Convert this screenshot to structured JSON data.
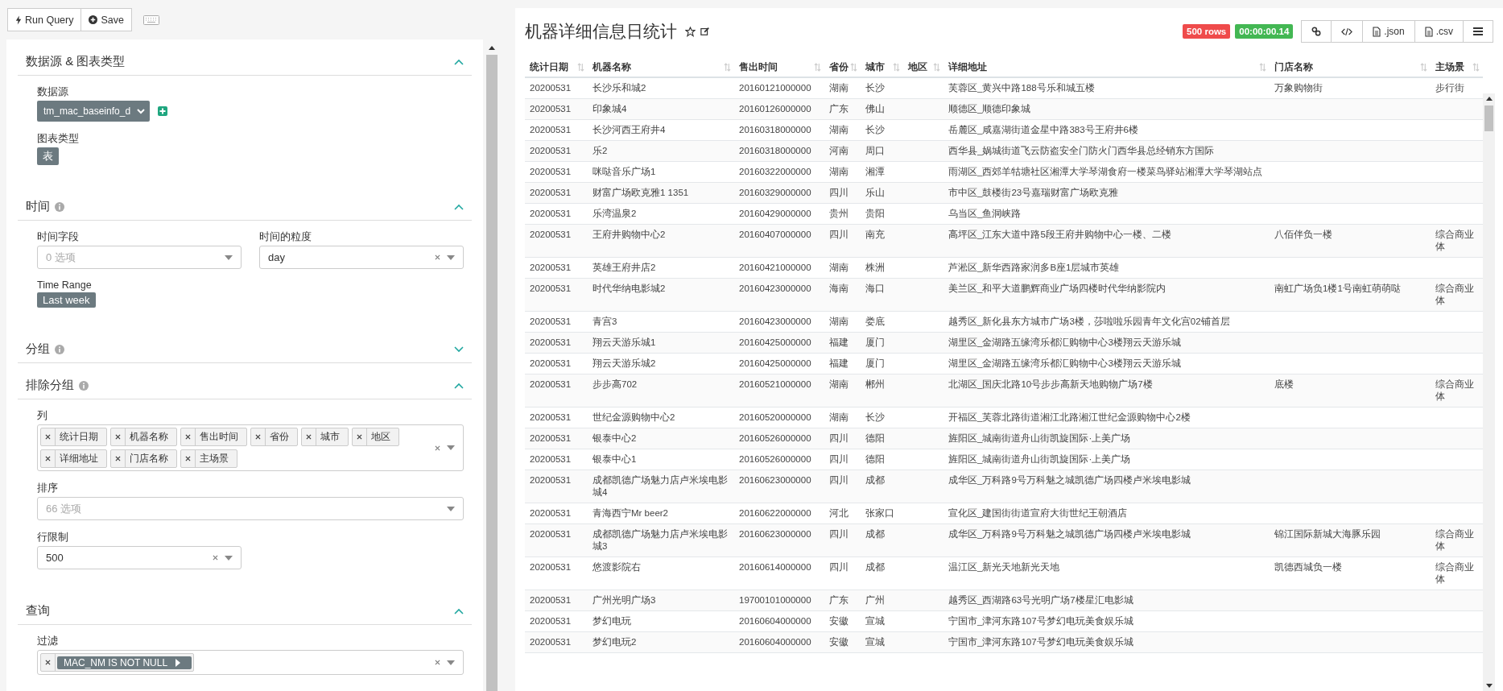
{
  "toolbar": {
    "buttons": [
      {
        "kind": "run",
        "label": "Run Query"
      },
      {
        "kind": "save",
        "label": "Save"
      }
    ]
  },
  "sections": [
    {
      "title": "数据源 & 图表类型",
      "info": false,
      "expanded": true,
      "controls": [
        {
          "kind": "datasource",
          "label": "数据源",
          "value": "tm_mac_baseinfo_d"
        },
        {
          "kind": "chip",
          "label": "图表类型",
          "value": "表"
        }
      ]
    },
    {
      "title": "时间",
      "info": true,
      "expanded": true,
      "controls": [
        {
          "kind": "select",
          "label": "时间字段",
          "placeholder": "0 选项",
          "clearable": false
        },
        {
          "kind": "select",
          "label": "时间的粒度",
          "value": "day",
          "clearable": true
        },
        {
          "kind": "chip",
          "label": "Time Range",
          "value": "Last week"
        }
      ]
    },
    {
      "title": "分组",
      "info": true,
      "expanded": false
    },
    {
      "title": "排除分组",
      "info": true,
      "expanded": true,
      "controls": [
        {
          "kind": "tags",
          "label": "列",
          "tags": [
            "统计日期",
            "机器名称",
            "售出时间",
            "省份",
            "城市",
            "地区",
            "详细地址",
            "门店名称",
            "主场景"
          ],
          "clearable": true
        },
        {
          "kind": "wide-select",
          "label": "排序",
          "placeholder": "66 选项",
          "clearable": false
        },
        {
          "kind": "select",
          "label": "行限制",
          "value": "500",
          "clearable": true
        }
      ]
    },
    {
      "title": "查询",
      "info": false,
      "expanded": true,
      "controls": [
        {
          "kind": "filters",
          "label": "过滤",
          "tags": [
            "MAC_NM IS NOT NULL"
          ],
          "clearable": true
        }
      ]
    }
  ],
  "result": {
    "title": "机器详细信息日统计",
    "row_count": "500 rows",
    "duration": "00:00:00.14",
    "actions": [
      {
        "kind": "link"
      },
      {
        "kind": "code"
      },
      {
        "kind": "json",
        "label": ".json"
      },
      {
        "kind": "csv",
        "label": ".csv"
      },
      {
        "kind": "menu"
      }
    ]
  },
  "table": {
    "columns": [
      "统计日期",
      "机器名称",
      "售出时间",
      "省份",
      "城市",
      "地区",
      "详细地址",
      "门店名称",
      "主场景"
    ],
    "rows": [
      [
        "20200531",
        "长沙乐和城2",
        "20160121000000",
        "湖南",
        "长沙",
        null,
        "芙蓉区_黄兴中路188号乐和城五楼",
        "万象购物街",
        "步行街"
      ],
      [
        "20200531",
        "印象城4",
        "20160126000000",
        "广东",
        "佛山",
        null,
        "顺德区_顺德印象城",
        null,
        null
      ],
      [
        "20200531",
        "长沙河西王府井4",
        "20160318000000",
        "湖南",
        "长沙",
        null,
        "岳麓区_咸嘉湖街道金星中路383号王府井6楼",
        null,
        null
      ],
      [
        "20200531",
        "乐2",
        "20160318000000",
        "河南",
        "周口",
        null,
        "西华县_娲城街道飞云防盗安全门防火门西华县总经销东方国际",
        null,
        null
      ],
      [
        "20200531",
        "咪哒音乐广场1",
        "20160322000000",
        "湖南",
        "湘潭",
        null,
        "雨湖区_西郊羊牯塘社区湘潭大学琴湖食府一楼菜鸟驿站湘潭大学琴湖站点",
        null,
        null
      ],
      [
        "20200531",
        "财富广场欧克雅1 1351",
        "20160329000000",
        "四川",
        "乐山",
        null,
        "市中区_鼓楼街23号嘉瑞财富广场欧克雅",
        null,
        null
      ],
      [
        "20200531",
        "乐湾温泉2",
        "20160429000000",
        "贵州",
        "贵阳",
        null,
        "乌当区_鱼洞峡路",
        null,
        null
      ],
      [
        "20200531",
        "王府井购物中心2",
        "20160407000000",
        "四川",
        "南充",
        null,
        "高坪区_江东大道中路5段王府井购物中心一楼、二楼",
        "八佰伴负一楼",
        "综合商业体"
      ],
      [
        "20200531",
        "英雄王府井店2",
        "20160421000000",
        "湖南",
        "株洲",
        null,
        "芦淞区_新华西路家润多B座1层城市英雄",
        null,
        null
      ],
      [
        "20200531",
        "时代华纳电影城2",
        "20160423000000",
        "海南",
        "海口",
        null,
        "美兰区_和平大道鹏辉商业广场四楼时代华纳影院内",
        "南虹广场负1楼1号南虹萌萌哒",
        "综合商业体"
      ],
      [
        "20200531",
        "青宫3",
        "20160423000000",
        "湖南",
        "娄底",
        null,
        "越秀区_新化县东方城市广场3楼，莎啦啦乐园青年文化宫02铺首层",
        null,
        null
      ],
      [
        "20200531",
        "翔云天游乐城1",
        "20160425000000",
        "福建",
        "厦门",
        null,
        "湖里区_金湖路五缘湾乐都汇购物中心3楼翔云天游乐城",
        null,
        null
      ],
      [
        "20200531",
        "翔云天游乐城2",
        "20160425000000",
        "福建",
        "厦门",
        null,
        "湖里区_金湖路五缘湾乐都汇购物中心3楼翔云天游乐城",
        null,
        null
      ],
      [
        "20200531",
        "步步高702",
        "20160521000000",
        "湖南",
        "郴州",
        null,
        "北湖区_国庆北路10号步步高新天地购物广场7楼",
        "底楼",
        "综合商业体"
      ],
      [
        "20200531",
        "世纪金源购物中心2",
        "20160520000000",
        "湖南",
        "长沙",
        null,
        "开福区_芙蓉北路街道湘江北路湘江世纪金源购物中心2楼",
        null,
        null
      ],
      [
        "20200531",
        "银泰中心2",
        "20160526000000",
        "四川",
        "德阳",
        null,
        "旌阳区_城南街道舟山街凯旋国际·上美广场",
        null,
        null
      ],
      [
        "20200531",
        "银泰中心1",
        "20160526000000",
        "四川",
        "德阳",
        null,
        "旌阳区_城南街道舟山街凯旋国际·上美广场",
        null,
        null
      ],
      [
        "20200531",
        "成都凯德广场魅力店卢米埃电影城4",
        "20160623000000",
        "四川",
        "成都",
        null,
        "成华区_万科路9号万科魅之城凯德广场四楼卢米埃电影城",
        null,
        null
      ],
      [
        "20200531",
        "青海西宁Mr beer2",
        "20160622000000",
        "河北",
        "张家口",
        null,
        "宣化区_建国街街道宣府大街世纪王朝酒店",
        null,
        null
      ],
      [
        "20200531",
        "成都凯德广场魅力店卢米埃电影城3",
        "20160623000000",
        "四川",
        "成都",
        null,
        "成华区_万科路9号万科魅之城凯德广场四楼卢米埃电影城",
        "锦江国际新城大海豚乐园",
        "综合商业体"
      ],
      [
        "20200531",
        "悠渡影院右",
        "20160614000000",
        "四川",
        "成都",
        null,
        "温江区_新光天地新光天地",
        "凯德西城负一楼",
        "综合商业体"
      ],
      [
        "20200531",
        "广州光明广场3",
        "19700101000000",
        "广东",
        "广州",
        null,
        "越秀区_西湖路63号光明广场7楼星汇电影城",
        null,
        null
      ],
      [
        "20200531",
        "梦幻电玩",
        "20160604000000",
        "安徽",
        "宣城",
        null,
        "宁国市_津河东路107号梦幻电玩美食娱乐城",
        null,
        null
      ],
      [
        "20200531",
        "梦幻电玩2",
        "20160604000000",
        "安徽",
        "宣城",
        null,
        "宁国市_津河东路107号梦幻电玩美食娱乐城",
        null,
        null
      ]
    ]
  }
}
